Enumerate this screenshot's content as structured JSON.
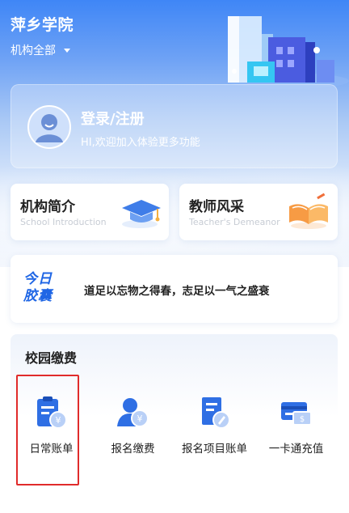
{
  "header": {
    "school_name": "萍乡学院",
    "org_select": "机构全部"
  },
  "login": {
    "title": "登录/注册",
    "subtitle": "HI,欢迎加入体验更多功能"
  },
  "tiles": [
    {
      "title": "机构简介",
      "subtitle": "School Introduction",
      "icon": "graduation-cap-icon"
    },
    {
      "title": "教师风采",
      "subtitle": "Teacher's Demeanor",
      "icon": "open-book-icon"
    }
  ],
  "daily": {
    "logo_line1": "今日",
    "logo_line2": "胶囊",
    "quote": "道足以忘物之得春，志足以一气之盛衰"
  },
  "payment": {
    "title": "校园缴费",
    "items": [
      {
        "label": "日常账单",
        "icon": "clipboard-bill-icon"
      },
      {
        "label": "报名缴费",
        "icon": "person-yuan-icon"
      },
      {
        "label": "报名项目账单",
        "icon": "document-pen-icon"
      },
      {
        "label": "一卡通充值",
        "icon": "campus-card-icon"
      }
    ]
  },
  "colors": {
    "brand_blue": "#3f86f6",
    "icon_blue": "#1f66e5",
    "highlight_red": "#e02b2b"
  }
}
